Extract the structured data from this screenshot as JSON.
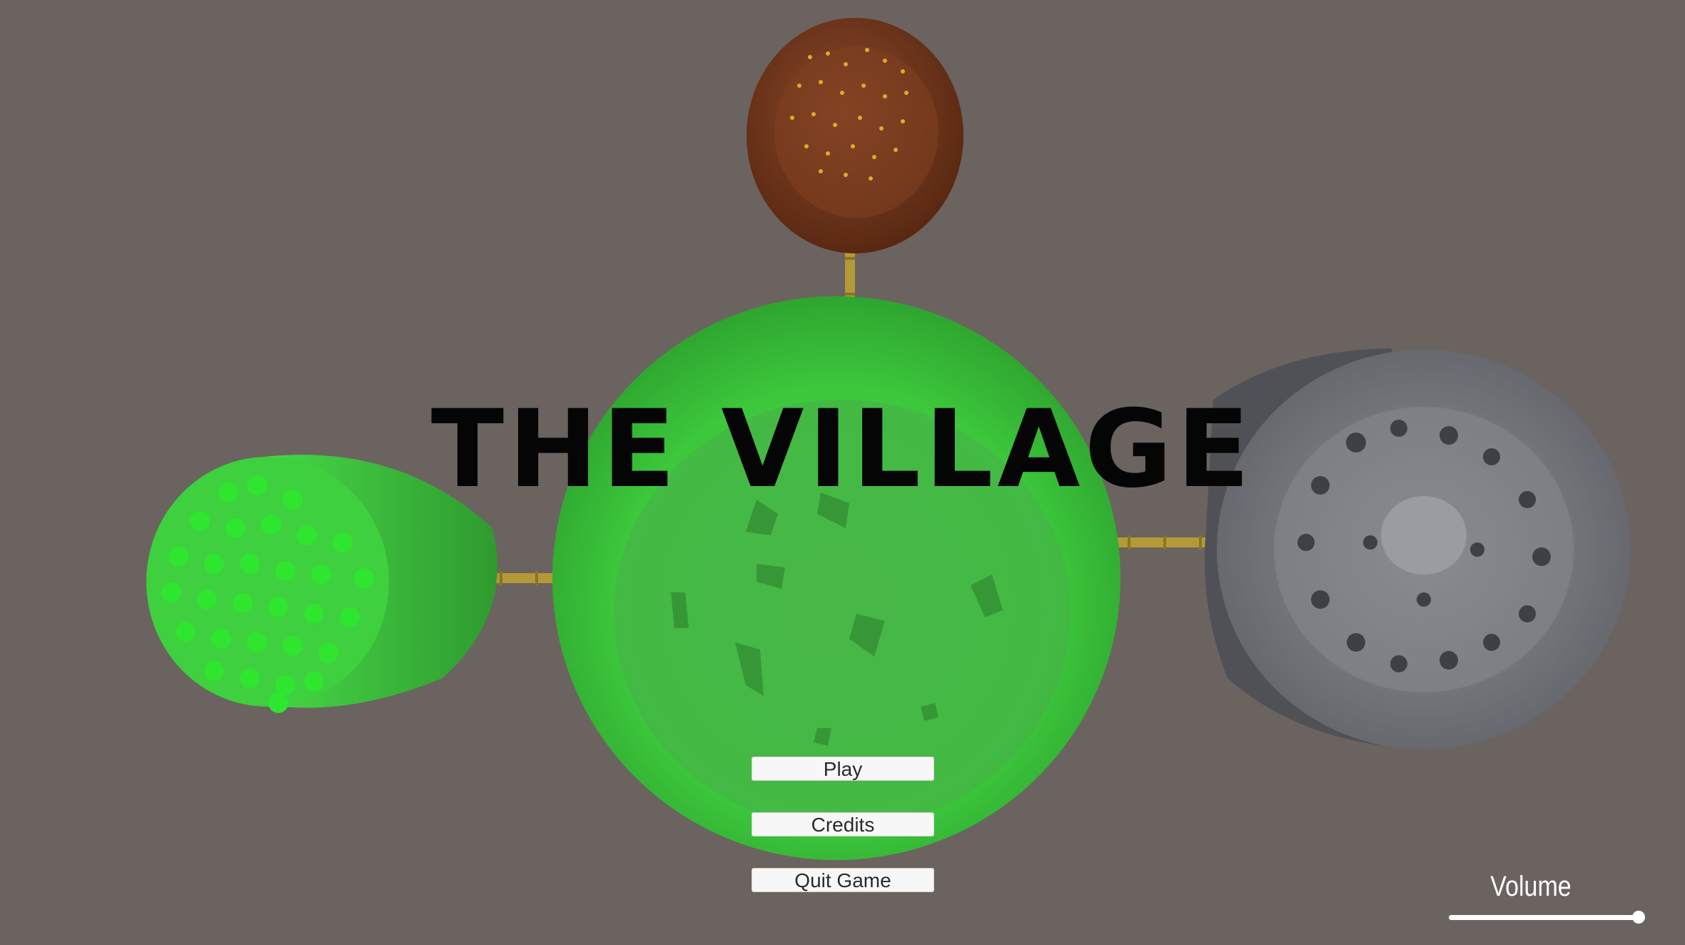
{
  "game": {
    "title": "THE VILLAGE"
  },
  "menu": {
    "play_label": "Play",
    "credits_label": "Credits",
    "quit_label": "Quit Game"
  },
  "volume": {
    "label": "Volume",
    "level": 1.0
  },
  "colors": {
    "background": "#6b635f",
    "center_island": "#3fd13f",
    "forest_island": "#3ee03e",
    "mud_island": "#7a3a20",
    "rock_island": "#7b7e84",
    "bridge": "#b39a38"
  }
}
